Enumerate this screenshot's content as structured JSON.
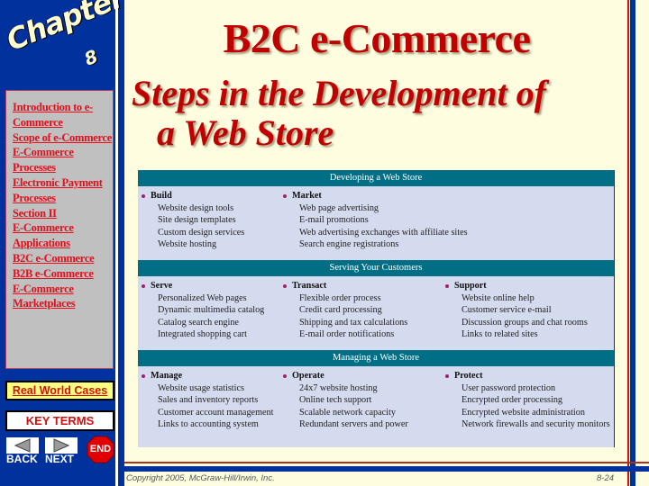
{
  "sidebar": {
    "logo_word": "Chapter",
    "logo_number": "8",
    "nav_links": [
      "Introduction to e-Commerce",
      "Scope of e-Commerce",
      "E-Commerce Processes",
      "Electronic Payment Processes",
      "Section II",
      "E-Commerce Applications",
      "B2C e-Commerce",
      "B2B e-Commerce",
      "E-Commerce Marketplaces"
    ],
    "real_world_cases": "Real World Cases",
    "key_terms": "KEY TERMS",
    "back_label": "BACK",
    "next_label": "NEXT",
    "end_label": "END"
  },
  "main": {
    "title": "B2C e-Commerce",
    "subtitle_line1": "Steps in the Development of",
    "subtitle_line2": "a Web Store",
    "figure": {
      "bands": [
        {
          "header": "Developing a Web Store",
          "columns": [
            {
              "heading": "Build",
              "items": [
                "Website design tools",
                "Site design templates",
                "Custom design services",
                "Website hosting"
              ]
            },
            {
              "heading": "Market",
              "items": [
                "Web page advertising",
                "E-mail promotions",
                "Web advertising exchanges with affiliate sites",
                "Search engine registrations"
              ]
            }
          ]
        },
        {
          "header": "Serving Your Customers",
          "columns": [
            {
              "heading": "Serve",
              "items": [
                "Personalized Web pages",
                "Dynamic multimedia catalog",
                "Catalog search engine",
                "Integrated shopping cart"
              ]
            },
            {
              "heading": "Transact",
              "items": [
                "Flexible order process",
                "Credit card processing",
                "Shipping and tax calculations",
                "E-mail order notifications"
              ]
            },
            {
              "heading": "Support",
              "items": [
                "Website online help",
                "Customer service e-mail",
                "Discussion groups and chat rooms",
                "Links to related sites"
              ]
            }
          ]
        },
        {
          "header": "Managing a Web Store",
          "columns": [
            {
              "heading": "Manage",
              "items": [
                "Website usage statistics",
                "Sales and inventory reports",
                "Customer account management",
                "Links to accounting system"
              ]
            },
            {
              "heading": "Operate",
              "items": [
                "24x7 website hosting",
                "Online tech support",
                "Scalable network capacity",
                "Redundant servers and power"
              ]
            },
            {
              "heading": "Protect",
              "items": [
                "User password protection",
                "Encrypted order processing",
                "Encrypted website administration",
                "Network firewalls and security monitors"
              ]
            }
          ]
        }
      ]
    }
  },
  "footer": {
    "copyright": "Copyright 2005, McGraw-Hill/Irwin, Inc.",
    "page_number": "8-24"
  },
  "colors": {
    "sidebar_blue": "#00319c",
    "title_red": "#c00000",
    "band_teal": "#006f86",
    "figure_bg": "#d5dbef",
    "page_bg": "#fffde0",
    "bullet": "#a0206a"
  }
}
